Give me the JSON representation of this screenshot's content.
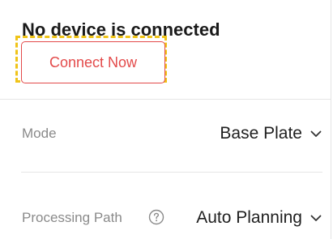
{
  "status": {
    "title": "No device is connected"
  },
  "connect_button": {
    "label": "Connect Now"
  },
  "fields": {
    "mode": {
      "label": "Mode",
      "value": "Base Plate",
      "icon": "chevron-down-icon"
    },
    "processing_path": {
      "label": "Processing Path",
      "value": "Auto Planning",
      "help_icon": "question-circle-icon",
      "icon": "chevron-down-icon"
    }
  },
  "colors": {
    "accent_red": "#e34a4a",
    "highlight_yellow": "#f0c419",
    "label_gray": "#8a8a8a"
  }
}
